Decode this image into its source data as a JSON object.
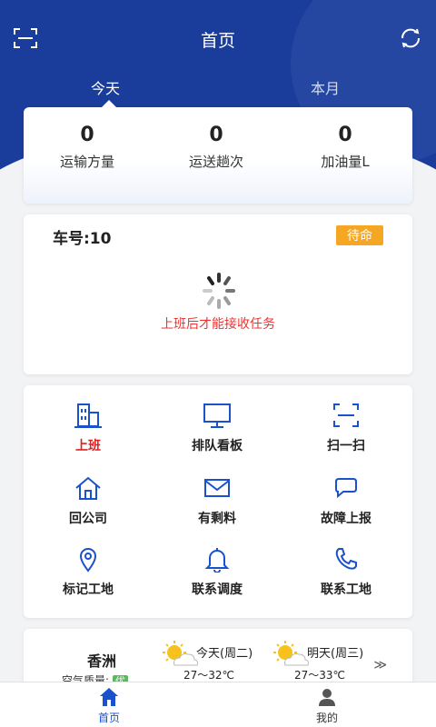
{
  "header": {
    "title": "首页",
    "scan_icon": "scan-icon",
    "refresh_icon": "refresh-icon"
  },
  "tabs": [
    {
      "label": "今天",
      "active": true
    },
    {
      "label": "本月",
      "active": false
    }
  ],
  "stats": [
    {
      "value": "0",
      "label": "运输方量"
    },
    {
      "value": "0",
      "label": "运送趟次"
    },
    {
      "value": "0",
      "label": "加油量L"
    }
  ],
  "vehicle": {
    "number_label": "车号:10",
    "status": "待命",
    "message": "上班后才能接收任务"
  },
  "grid": [
    {
      "label": "上班",
      "icon": "building-icon"
    },
    {
      "label": "排队看板",
      "icon": "monitor-icon"
    },
    {
      "label": "扫一扫",
      "icon": "scan-icon"
    },
    {
      "label": "回公司",
      "icon": "home-icon"
    },
    {
      "label": "有剩料",
      "icon": "envelope-icon"
    },
    {
      "label": "故障上报",
      "icon": "chat-icon"
    },
    {
      "label": "标记工地",
      "icon": "location-pin-icon"
    },
    {
      "label": "联系调度",
      "icon": "bell-icon"
    },
    {
      "label": "联系工地",
      "icon": "phone-icon"
    }
  ],
  "weather": {
    "city": "香洲",
    "aqi_label": "空气质量:",
    "aqi_value": "优",
    "days": [
      {
        "name": "今天(周二)",
        "temp": "27～32℃",
        "icon": "partly-cloudy-icon"
      },
      {
        "name": "明天(周三)",
        "temp": "27～33℃",
        "icon": "partly-cloudy-icon"
      }
    ],
    "more": "≫"
  },
  "bottom_nav": [
    {
      "label": "首页",
      "icon": "home-icon",
      "active": true
    },
    {
      "label": "我的",
      "icon": "user-icon",
      "active": false
    }
  ],
  "colors": {
    "brand": "#1a3d9c",
    "accent": "#1a52cc",
    "status_badge": "#f5a623",
    "alert": "#e02020"
  }
}
